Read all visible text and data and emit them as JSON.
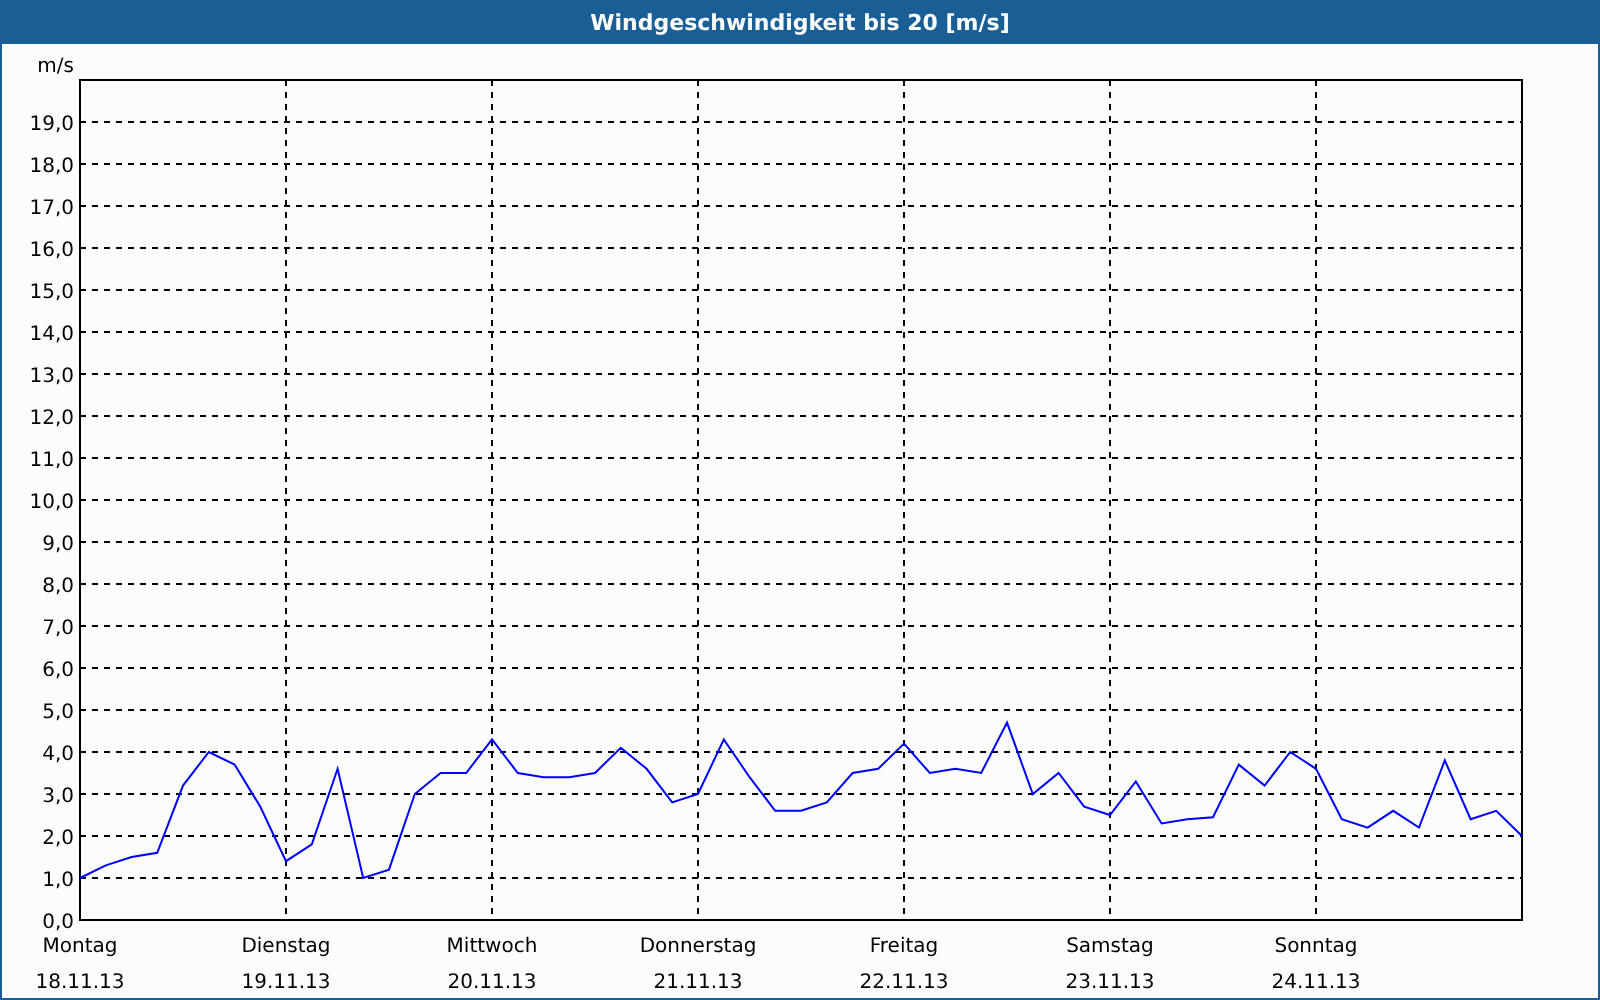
{
  "window": {
    "title": "Windgeschwindigkeit bis 20 [m/s]"
  },
  "chart": {
    "x_dates": [
      "18.11.13",
      "19.11.13",
      "20.11.13",
      "21.11.13",
      "22.11.13",
      "23.11.13",
      "24.11.13"
    ],
    "chart_data": {
      "type": "line",
      "grid": true,
      "ylabel": "m/s",
      "ylim": [
        0,
        20
      ],
      "yticks": [
        {
          "value": 0,
          "label": "0,0"
        },
        {
          "value": 1,
          "label": "1,0"
        },
        {
          "value": 2,
          "label": "2,0"
        },
        {
          "value": 3,
          "label": "3,0"
        },
        {
          "value": 4,
          "label": "4,0"
        },
        {
          "value": 5,
          "label": "5,0"
        },
        {
          "value": 6,
          "label": "6,0"
        },
        {
          "value": 7,
          "label": "7,0"
        },
        {
          "value": 8,
          "label": "8,0"
        },
        {
          "value": 9,
          "label": "9,0"
        },
        {
          "value": 10,
          "label": "10,0"
        },
        {
          "value": 11,
          "label": "11,0"
        },
        {
          "value": 12,
          "label": "12,0"
        },
        {
          "value": 13,
          "label": "13,0"
        },
        {
          "value": 14,
          "label": "14,0"
        },
        {
          "value": 15,
          "label": "15,0"
        },
        {
          "value": 16,
          "label": "16,0"
        },
        {
          "value": 17,
          "label": "17,0"
        },
        {
          "value": 18,
          "label": "18,0"
        },
        {
          "value": 19,
          "label": "19,0"
        }
      ],
      "categories": [
        "Montag",
        null,
        null,
        null,
        null,
        null,
        null,
        null,
        "Dienstag",
        null,
        null,
        null,
        null,
        null,
        null,
        null,
        "Mittwoch",
        null,
        null,
        null,
        null,
        null,
        null,
        null,
        "Donnerstag",
        null,
        null,
        null,
        null,
        null,
        null,
        null,
        "Freitag",
        null,
        null,
        null,
        null,
        null,
        null,
        null,
        "Samstag",
        null,
        null,
        null,
        null,
        null,
        null,
        null,
        "Sonntag",
        null,
        null,
        null,
        null,
        null,
        null,
        null,
        null
      ],
      "series": [
        {
          "color": "#0000ff",
          "values": [
            1.0,
            1.3,
            1.5,
            1.6,
            3.2,
            4.0,
            3.7,
            2.7,
            1.4,
            1.8,
            3.6,
            1.0,
            1.2,
            3.0,
            3.5,
            3.5,
            4.3,
            3.5,
            3.4,
            3.4,
            3.5,
            4.1,
            3.6,
            2.8,
            3.0,
            4.3,
            3.4,
            2.6,
            2.6,
            2.8,
            3.5,
            3.6,
            4.2,
            3.5,
            3.6,
            3.5,
            4.7,
            3.0,
            3.5,
            2.7,
            2.5,
            3.3,
            2.3,
            2.4,
            2.45,
            3.7,
            3.2,
            4.0,
            3.6,
            2.4,
            2.2,
            2.6,
            2.2,
            3.8,
            2.4,
            2.6,
            2.0
          ]
        }
      ]
    }
  }
}
